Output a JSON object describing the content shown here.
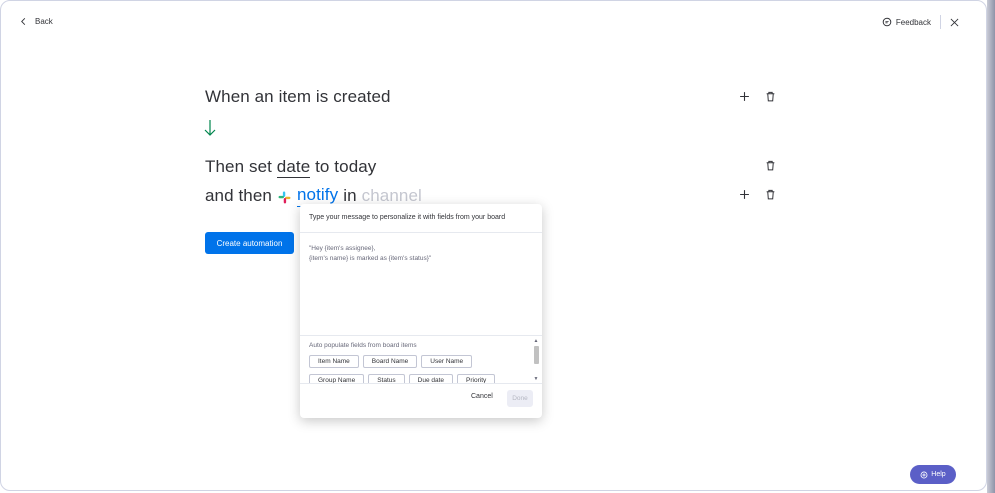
{
  "nav": {
    "back_label": "Back",
    "feedback_label": "Feedback"
  },
  "recipe": {
    "trigger": "When an item is created",
    "action1": {
      "prefix": "Then set",
      "field": "date",
      "suffix": "to today"
    },
    "action2": {
      "prefix": "and then",
      "field": "notify",
      "connector": "in",
      "placeholder": "channel"
    }
  },
  "create_button": "Create automation",
  "popup": {
    "header": "Type your message to personalize it with fields from your board",
    "message_line1": "\"Hey {item's assignee},",
    "message_line2": "{item's name} is marked as {item's status}\"",
    "fields_title": "Auto populate fields from board items",
    "chips": [
      "Item Name",
      "Board Name",
      "User Name",
      "Group Name",
      "Status",
      "Due date",
      "Priority"
    ],
    "cancel": "Cancel",
    "done": "Done"
  },
  "help_label": "Help",
  "colors": {
    "primary": "#0073ea",
    "help": "#5b5fc7",
    "arrow": "#00854d"
  }
}
